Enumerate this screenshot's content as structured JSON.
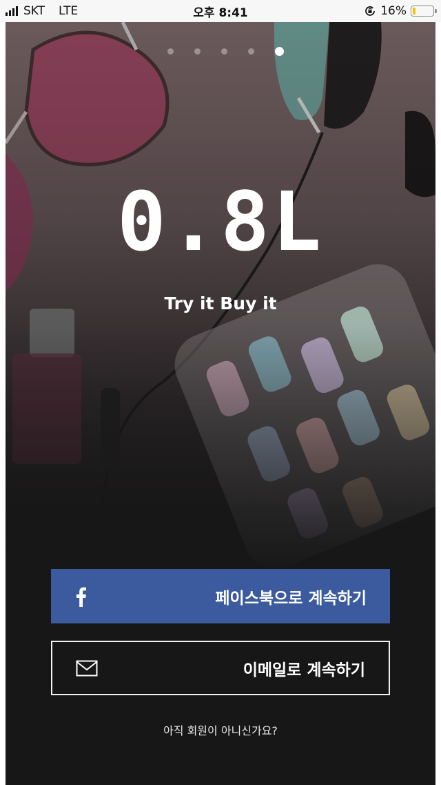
{
  "status_bar": {
    "carrier": "SKT",
    "network": "LTE",
    "time": "오후 8:41",
    "battery_percent_label": "16%",
    "battery_level": 0.16,
    "battery_color": "#f5c400"
  },
  "pager": {
    "total": 5,
    "active_index": 4
  },
  "brand": {
    "logo_text": "0.8L",
    "tagline": "Try it Buy it"
  },
  "actions": {
    "facebook": {
      "label": "페이스북으로 계속하기",
      "icon": "facebook-icon",
      "color": "#3b5b9e"
    },
    "email": {
      "label": "이메일로 계속하기",
      "icon": "mail-icon"
    }
  },
  "signup_prompt": "아직 회원이 아니신가요?"
}
